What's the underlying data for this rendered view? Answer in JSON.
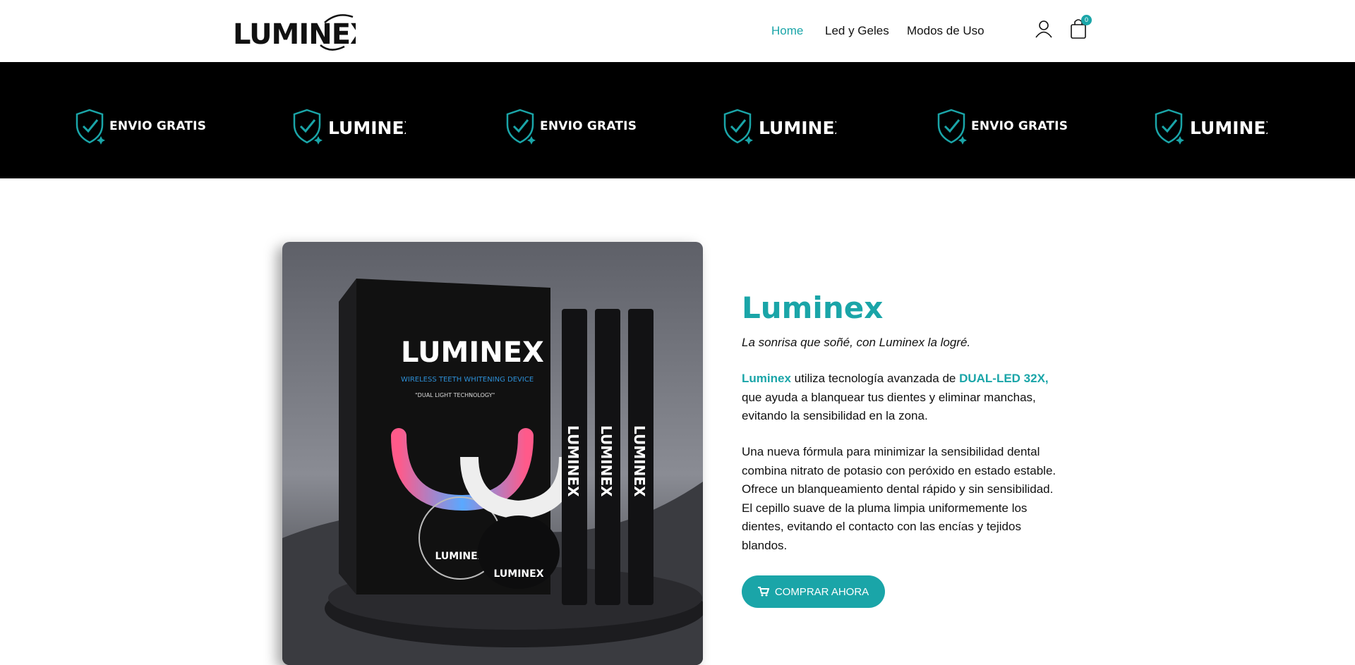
{
  "brand": {
    "logo_text": "LUMINEX"
  },
  "colors": {
    "accent": "#1aa5a8",
    "band_bg": "#000000",
    "text": "#111111"
  },
  "nav": {
    "items": [
      {
        "label": "Home",
        "active": true
      },
      {
        "label": "Led y Geles",
        "active": false
      },
      {
        "label": "Modos de Uso",
        "active": false
      }
    ],
    "user_icon": "user-icon",
    "cart_icon": "shopping-bag-icon",
    "cart_count": "0"
  },
  "band": {
    "items": [
      {
        "type": "text",
        "label": "ENVIO GRATIS"
      },
      {
        "type": "logo",
        "label": "LUMINEX"
      },
      {
        "type": "text",
        "label": "ENVIO GRATIS"
      },
      {
        "type": "logo",
        "label": "LUMINEX"
      },
      {
        "type": "text",
        "label": "ENVIO GRATIS"
      },
      {
        "type": "logo",
        "label": "LUMINEX"
      }
    ],
    "icon": "shield-check-icon"
  },
  "product_image": {
    "box_brand": "LUMINEX",
    "box_subtitle": "WIRELESS TEETH WHITENING DEVICE",
    "box_tagline": "\"DUAL LIGHT TECHNOLOGY\"",
    "pen_brand": "LUMINEX"
  },
  "product": {
    "title": "Luminex",
    "tagline": "La sonrisa que soñé, con Luminex la logré.",
    "para1_highlight1": "Luminex",
    "para1_text1": " utiliza tecnología avanzada de ",
    "para1_highlight2": "DUAL-LED 32X,",
    "para1_text2": " que ayuda a blanquear tus dientes y eliminar manchas, evitando la sensibilidad en la zona.",
    "para2": "Una nueva fórmula para minimizar la sensibilidad dental combina nitrato de potasio con peróxido en estado estable. Ofrece un blanqueamiento dental rápido y sin sensibilidad. El cepillo suave de la pluma limpia uniformemente los dientes, evitando el contacto con las encías y tejidos blandos.",
    "cta_label": "COMPRAR AHORA",
    "cta_icon": "cart-icon"
  }
}
